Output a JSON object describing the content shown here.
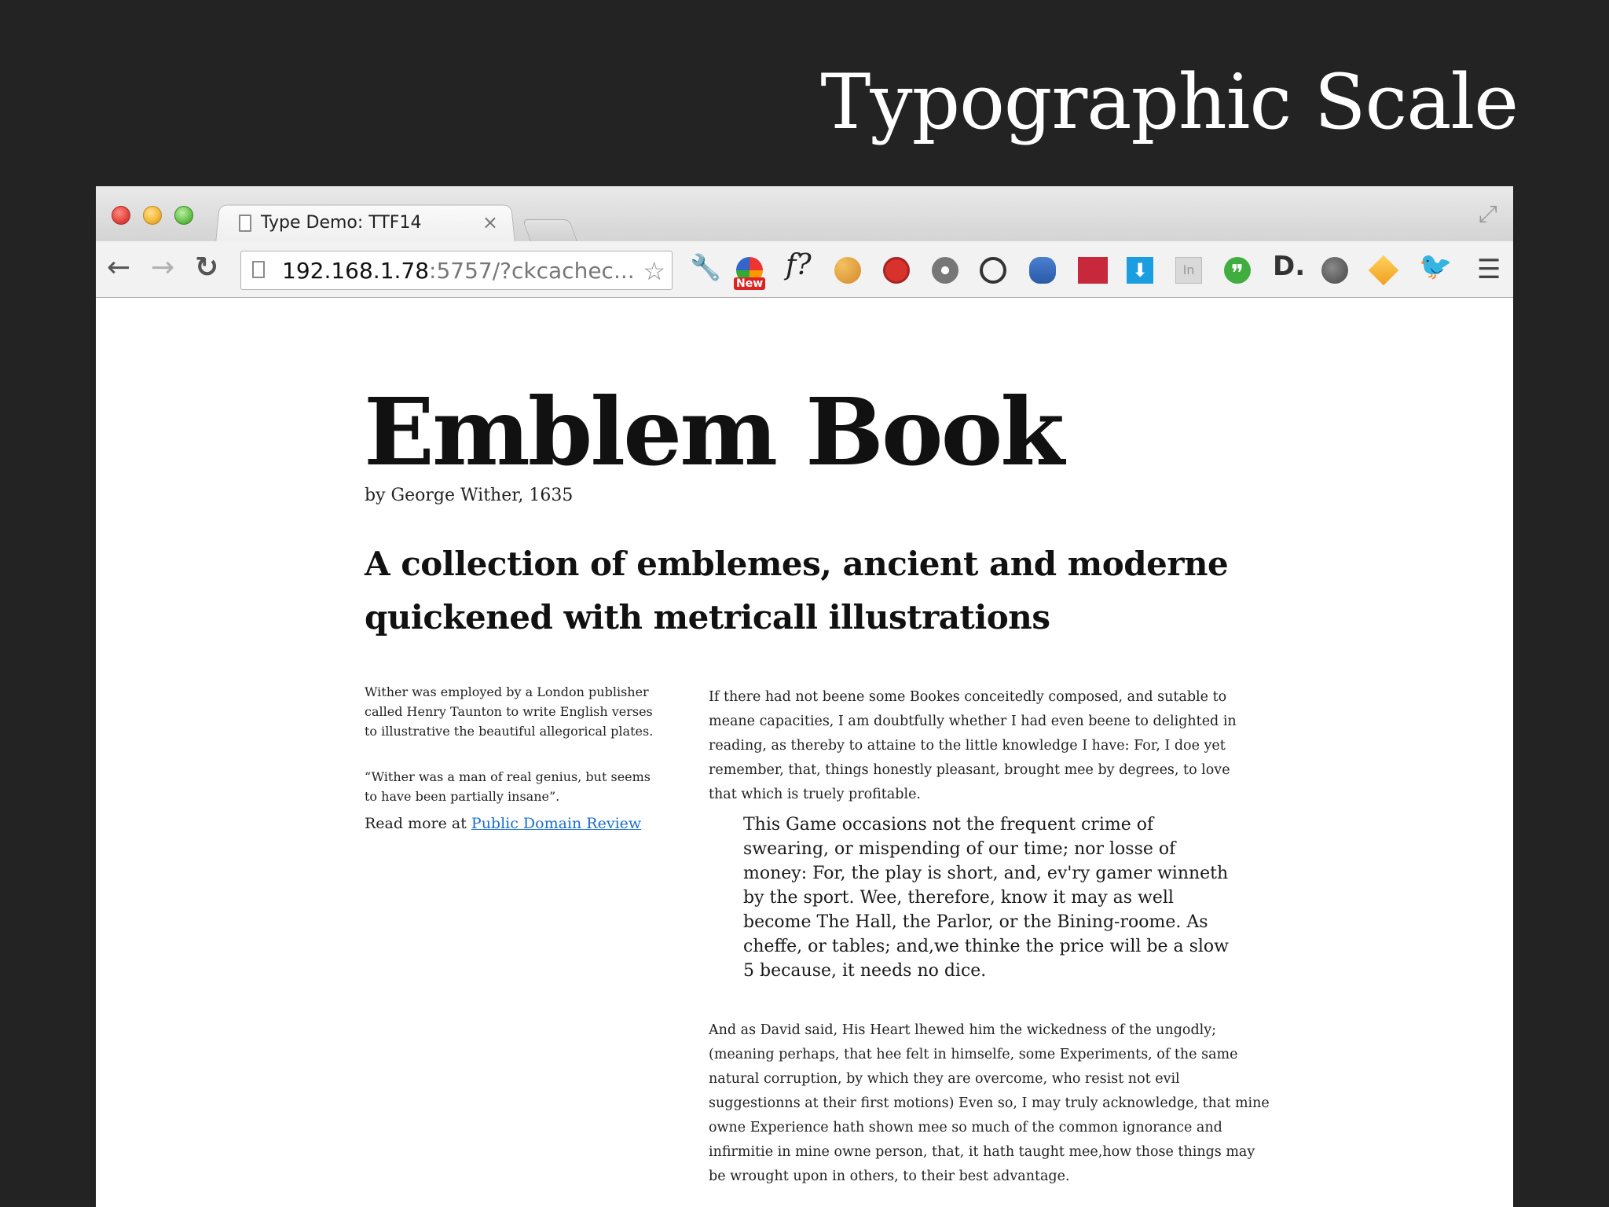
{
  "slide": {
    "title": "Typographic Scale"
  },
  "browser": {
    "tab": {
      "label": "Type Demo: TTF14",
      "close_glyph": "×"
    },
    "fullscreen_glyph": "⤢",
    "nav": {
      "back_glyph": "←",
      "forward_glyph": "→",
      "reload_glyph": "↻"
    },
    "address": {
      "host": "192.168.1.78",
      "rest": ":5757/?ckcachec...",
      "star_glyph": "☆"
    },
    "extensions": {
      "wrench_glyph": "🔧",
      "color_badge": "New",
      "f_label": "f?",
      "download_glyph": "⬇",
      "in_label": "In",
      "quote_glyph": "❞",
      "d_label": "D.",
      "bird_glyph": "🐦"
    },
    "menu_glyph": "☰"
  },
  "page": {
    "title": "Emblem Book",
    "byline": "by George Wither, 1635",
    "subtitle": "A collection of emblemes, ancient and moderne quickened with metricall illustrations",
    "sidebar": {
      "p1": "Wither was employed by a London publisher called Henry Taunton to write English verses to illustrative the beautiful allegorical plates.",
      "p2": "“Wither was a man of real genius, but seems to have been partially insane”.",
      "read_more_prefix": "Read more at ",
      "read_more_link": "Public Domain Review"
    },
    "main": {
      "p1": "If there had not beene some Bookes conceitedly composed, and sutable to meane capacities, I am doubtfully whether I had even beene to delighted in reading, as thereby to attaine to the little knowledge I have: For, I doe yet remember, that, things honestly pleasant, brought mee by degrees, to love that which is truely profitable.",
      "quote": "This Game occasions not the frequent crime of swearing, or mispending of our time; nor losse of money: For, the play is short, and, ev'ry gamer winneth by the sport. Wee, therefore, know it may as well become The Hall, the Parlor, or the Bining-roome. As cheffe, or tables; and,we thinke the price will be a slow 5 because, it needs no dice.",
      "p2": "And as David said, His Heart lhewed him the wickedness of the ungodly; (meaning perhaps, that hee felt in himselfe, some Experiments, of the same natural corruption, by which they are overcome, who resist not evil suggestionns at their first motions) Even so, I may truly acknowledge, that mine owne Experience hath shown mee so much of the common ignorance and infirmitie in mine owne person, that, it hath taught mee,how those things may be wrought upon in others, to their best advantage."
    }
  }
}
